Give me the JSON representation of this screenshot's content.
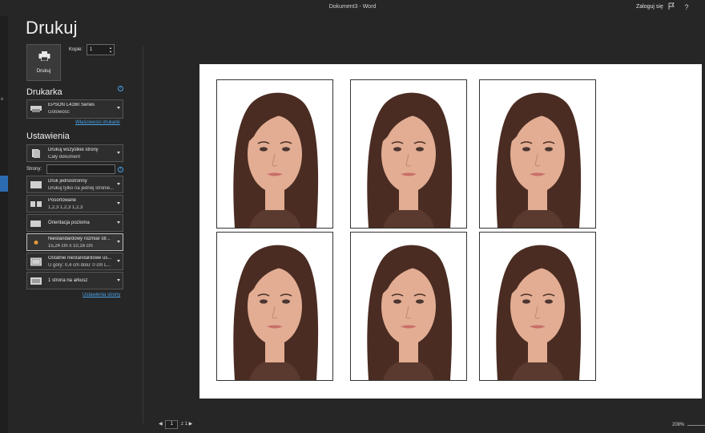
{
  "window": {
    "title": "Dokument3  -  Word",
    "signin_label": "Zaloguj się",
    "icons": [
      "feedback-icon",
      "help-icon"
    ],
    "help_glyph": "?"
  },
  "rail": {
    "marker": "e"
  },
  "print": {
    "heading": "Drukuj",
    "print_button_label": "Drukuj",
    "copies_label": "Kopie:",
    "copies_value": "1",
    "copies_spin_up": "▲",
    "copies_spin_down": "▼"
  },
  "printer": {
    "section_title": "Drukarka",
    "info_glyph": "i",
    "name": "EPSON L4160 Series",
    "status": "Gotowość",
    "properties_link": "Właściwości drukarki"
  },
  "settings": {
    "section_title": "Ustawienia",
    "items": [
      {
        "line1": "Drukuj wszystkie strony",
        "line2": "Cały dokument",
        "icon": "pages-icon"
      },
      {
        "line1": "Druk jednostronny",
        "line2": "Drukuj tylko na jednej stronie...",
        "icon": "one-sided-icon"
      },
      {
        "line1": "Posortowane",
        "line2": "1,2,3    1,2,3    1,2,3",
        "icon": "collated-icon"
      },
      {
        "line1": "Orientacja pozioma",
        "line2": "",
        "icon": "landscape-icon"
      },
      {
        "line1": "Niestandardowy rozmiar str...",
        "line2": "15,24  cm x 10,16  cm",
        "icon": "paper-size-icon"
      },
      {
        "line1": "Ostatnie niestandardowe us...",
        "line2": "U góry: 0,4  cm dolu: 0  cm L...",
        "icon": "margins-icon"
      },
      {
        "line1": "1 strona na arkusz",
        "line2": "",
        "icon": "pages-per-sheet-icon"
      }
    ],
    "pages_label": "Strony:",
    "pages_value": "",
    "page_setup_link": "Ustawienia strony"
  },
  "preview": {
    "photo_count": 6,
    "skin_color": "#e2ad93",
    "hair_color": "#4a2c22",
    "page_nav": {
      "prev": "◀",
      "current": "1",
      "of": "z 1",
      "next": "▶"
    },
    "zoom": "208%"
  }
}
